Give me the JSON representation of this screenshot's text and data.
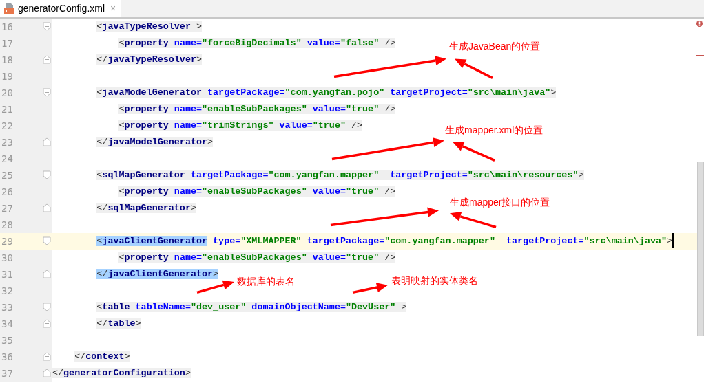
{
  "tab": {
    "title": "generatorConfig.xml",
    "close": "×",
    "selected": true
  },
  "lines": [
    {
      "number": "16",
      "kind": "open",
      "current": false,
      "tags": [
        {
          "parts": [
            {
              "kind": "bracket",
              "text": "<",
              "selected": false
            },
            {
              "kind": "name",
              "text": "javaTypeResolver",
              "selected": false
            },
            {
              "kind": "bracket",
              "text": " >",
              "selected": false
            }
          ]
        }
      ]
    },
    {
      "number": "17",
      "kind": "plain",
      "current": false,
      "tags": [
        {
          "parts": [
            {
              "kind": "bracket",
              "text": "<",
              "selected": false
            },
            {
              "kind": "name",
              "text": "property",
              "selected": false
            },
            {
              "kind": "attr",
              "text": " name=",
              "selected": false
            },
            {
              "kind": "value",
              "text": "\"forceBigDecimals\"",
              "selected": false
            },
            {
              "kind": "attr",
              "text": " value=",
              "selected": false
            },
            {
              "kind": "value",
              "text": "\"false\"",
              "selected": false
            },
            {
              "kind": "bracket",
              "text": " />",
              "selected": false
            }
          ]
        }
      ]
    },
    {
      "number": "18",
      "kind": "close",
      "current": false,
      "tags": [
        {
          "parts": [
            {
              "kind": "bracket",
              "text": "</",
              "selected": false
            },
            {
              "kind": "name",
              "text": "javaTypeResolver",
              "selected": false
            },
            {
              "kind": "bracket",
              "text": ">",
              "selected": false
            }
          ]
        }
      ]
    },
    {
      "number": "19",
      "kind": "plain",
      "current": false
    },
    {
      "number": "20",
      "kind": "open",
      "current": false,
      "tags": [
        {
          "parts": [
            {
              "kind": "bracket",
              "text": "<",
              "selected": false
            },
            {
              "kind": "name",
              "text": "javaModelGenerator",
              "selected": false
            },
            {
              "kind": "attr",
              "text": " targetPackage=",
              "selected": false
            },
            {
              "kind": "value",
              "text": "\"com.yangfan.pojo\"",
              "selected": false
            },
            {
              "kind": "attr",
              "text": " targetProject=",
              "selected": false
            },
            {
              "kind": "value",
              "text": "\"src\\main\\java\"",
              "selected": false
            },
            {
              "kind": "bracket",
              "text": ">",
              "selected": false
            }
          ]
        }
      ]
    },
    {
      "number": "21",
      "kind": "plain",
      "current": false,
      "tags": [
        {
          "parts": [
            {
              "kind": "bracket",
              "text": "<",
              "selected": false
            },
            {
              "kind": "name",
              "text": "property",
              "selected": false
            },
            {
              "kind": "attr",
              "text": " name=",
              "selected": false
            },
            {
              "kind": "value",
              "text": "\"enableSubPackages\"",
              "selected": false
            },
            {
              "kind": "attr",
              "text": " value=",
              "selected": false
            },
            {
              "kind": "value",
              "text": "\"true\"",
              "selected": false
            },
            {
              "kind": "bracket",
              "text": " />",
              "selected": false
            }
          ]
        }
      ]
    },
    {
      "number": "22",
      "kind": "plain",
      "current": false,
      "tags": [
        {
          "parts": [
            {
              "kind": "bracket",
              "text": "<",
              "selected": false
            },
            {
              "kind": "name",
              "text": "property",
              "selected": false
            },
            {
              "kind": "attr",
              "text": " name=",
              "selected": false
            },
            {
              "kind": "value",
              "text": "\"trimStrings\"",
              "selected": false
            },
            {
              "kind": "attr",
              "text": " value=",
              "selected": false
            },
            {
              "kind": "value",
              "text": "\"true\"",
              "selected": false
            },
            {
              "kind": "bracket",
              "text": " />",
              "selected": false
            }
          ]
        }
      ]
    },
    {
      "number": "23",
      "kind": "close",
      "current": false,
      "tags": [
        {
          "parts": [
            {
              "kind": "bracket",
              "text": "</",
              "selected": false
            },
            {
              "kind": "name",
              "text": "javaModelGenerator",
              "selected": false
            },
            {
              "kind": "bracket",
              "text": ">",
              "selected": false
            }
          ]
        }
      ]
    },
    {
      "number": "24",
      "kind": "plain",
      "current": false
    },
    {
      "number": "25",
      "kind": "open",
      "current": false,
      "tags": [
        {
          "parts": [
            {
              "kind": "bracket",
              "text": "<",
              "selected": false
            },
            {
              "kind": "name",
              "text": "sqlMapGenerator",
              "selected": false
            },
            {
              "kind": "attr",
              "text": " targetPackage=",
              "selected": false
            },
            {
              "kind": "value",
              "text": "\"com.yangfan.mapper\"",
              "selected": false
            },
            {
              "kind": "attr",
              "text": "  targetProject=",
              "selected": false
            },
            {
              "kind": "value",
              "text": "\"src\\main\\resources\"",
              "selected": false
            },
            {
              "kind": "bracket",
              "text": ">",
              "selected": false
            }
          ]
        }
      ]
    },
    {
      "number": "26",
      "kind": "plain",
      "current": false,
      "tags": [
        {
          "parts": [
            {
              "kind": "bracket",
              "text": "<",
              "selected": false
            },
            {
              "kind": "name",
              "text": "property",
              "selected": false
            },
            {
              "kind": "attr",
              "text": " name=",
              "selected": false
            },
            {
              "kind": "value",
              "text": "\"enableSubPackages\"",
              "selected": false
            },
            {
              "kind": "attr",
              "text": " value=",
              "selected": false
            },
            {
              "kind": "value",
              "text": "\"true\"",
              "selected": false
            },
            {
              "kind": "bracket",
              "text": " />",
              "selected": false
            }
          ]
        }
      ]
    },
    {
      "number": "27",
      "kind": "close",
      "current": false,
      "tags": [
        {
          "parts": [
            {
              "kind": "bracket",
              "text": "</",
              "selected": false
            },
            {
              "kind": "name",
              "text": "sqlMapGenerator",
              "selected": false
            },
            {
              "kind": "bracket",
              "text": ">",
              "selected": false
            }
          ]
        }
      ]
    },
    {
      "number": "28",
      "kind": "plain",
      "current": false
    },
    {
      "number": "29",
      "kind": "open",
      "current": true,
      "tags": [
        {
          "parts": [
            {
              "kind": "bracket",
              "text": "<",
              "selected": true
            },
            {
              "kind": "name",
              "text": "javaClientGenerator",
              "selected": true
            },
            {
              "kind": "attr",
              "text": " type=",
              "selected": false
            },
            {
              "kind": "value",
              "text": "\"XMLMAPPER\"",
              "selected": false
            },
            {
              "kind": "attr",
              "text": " targetPackage=",
              "selected": false
            },
            {
              "kind": "value",
              "text": "\"com.yangfan.mapper\"",
              "selected": false
            },
            {
              "kind": "attr",
              "text": "  targetProject=",
              "selected": false
            },
            {
              "kind": "value",
              "text": "\"src\\main\\java\"",
              "selected": false
            },
            {
              "kind": "bracket",
              "text": ">",
              "selected": false
            }
          ]
        }
      ]
    },
    {
      "number": "30",
      "kind": "plain",
      "current": false,
      "tags": [
        {
          "parts": [
            {
              "kind": "bracket",
              "text": "<",
              "selected": false
            },
            {
              "kind": "name",
              "text": "property",
              "selected": false
            },
            {
              "kind": "attr",
              "text": " name=",
              "selected": false
            },
            {
              "kind": "value",
              "text": "\"enableSubPackages\"",
              "selected": false
            },
            {
              "kind": "attr",
              "text": " value=",
              "selected": false
            },
            {
              "kind": "value",
              "text": "\"true\"",
              "selected": false
            },
            {
              "kind": "bracket",
              "text": " />",
              "selected": false
            }
          ]
        }
      ]
    },
    {
      "number": "31",
      "kind": "close",
      "current": false,
      "tags": [
        {
          "parts": [
            {
              "kind": "bracket",
              "text": "</",
              "selected": true
            },
            {
              "kind": "name",
              "text": "javaClientGenerator",
              "selected": true
            },
            {
              "kind": "bracket",
              "text": ">",
              "selected": true
            }
          ]
        }
      ]
    },
    {
      "number": "32",
      "kind": "plain",
      "current": false
    },
    {
      "number": "33",
      "kind": "open",
      "current": false,
      "tags": [
        {
          "parts": [
            {
              "kind": "bracket",
              "text": "<",
              "selected": false
            },
            {
              "kind": "name",
              "text": "table",
              "selected": false
            },
            {
              "kind": "attr",
              "text": " tableName=",
              "selected": false
            },
            {
              "kind": "value",
              "text": "\"dev_user\"",
              "selected": false
            },
            {
              "kind": "attr",
              "text": " domainObjectName=",
              "selected": false
            },
            {
              "kind": "value",
              "text": "\"DevUser\"",
              "selected": false
            },
            {
              "kind": "bracket",
              "text": " >",
              "selected": false
            }
          ]
        }
      ]
    },
    {
      "number": "34",
      "kind": "close",
      "current": false,
      "tags": [
        {
          "parts": [
            {
              "kind": "bracket",
              "text": "</",
              "selected": false
            },
            {
              "kind": "name",
              "text": "table",
              "selected": false
            },
            {
              "kind": "bracket",
              "text": ">",
              "selected": false
            }
          ]
        }
      ]
    },
    {
      "number": "35",
      "kind": "plain",
      "current": false
    },
    {
      "number": "36",
      "kind": "close",
      "current": false,
      "tags": [
        {
          "parts": [
            {
              "kind": "bracket",
              "text": "</",
              "selected": false
            },
            {
              "kind": "name",
              "text": "context",
              "selected": false
            },
            {
              "kind": "bracket",
              "text": ">",
              "selected": false
            }
          ]
        }
      ]
    },
    {
      "number": "37",
      "kind": "close",
      "current": false,
      "tags": [
        {
          "parts": [
            {
              "kind": "bracket",
              "text": "</",
              "selected": false
            },
            {
              "kind": "name",
              "text": "generatorConfiguration",
              "selected": false
            },
            {
              "kind": "bracket",
              "text": ">",
              "selected": false
            }
          ]
        }
      ]
    }
  ],
  "annotations": [
    {
      "text": "生成JavaBean的位置"
    },
    {
      "text": "生成mapper.xml的位置"
    },
    {
      "text": "生成mapper接口的位置"
    },
    {
      "text": "数据库的表名"
    },
    {
      "text": "表明映射的实体类名"
    }
  ]
}
